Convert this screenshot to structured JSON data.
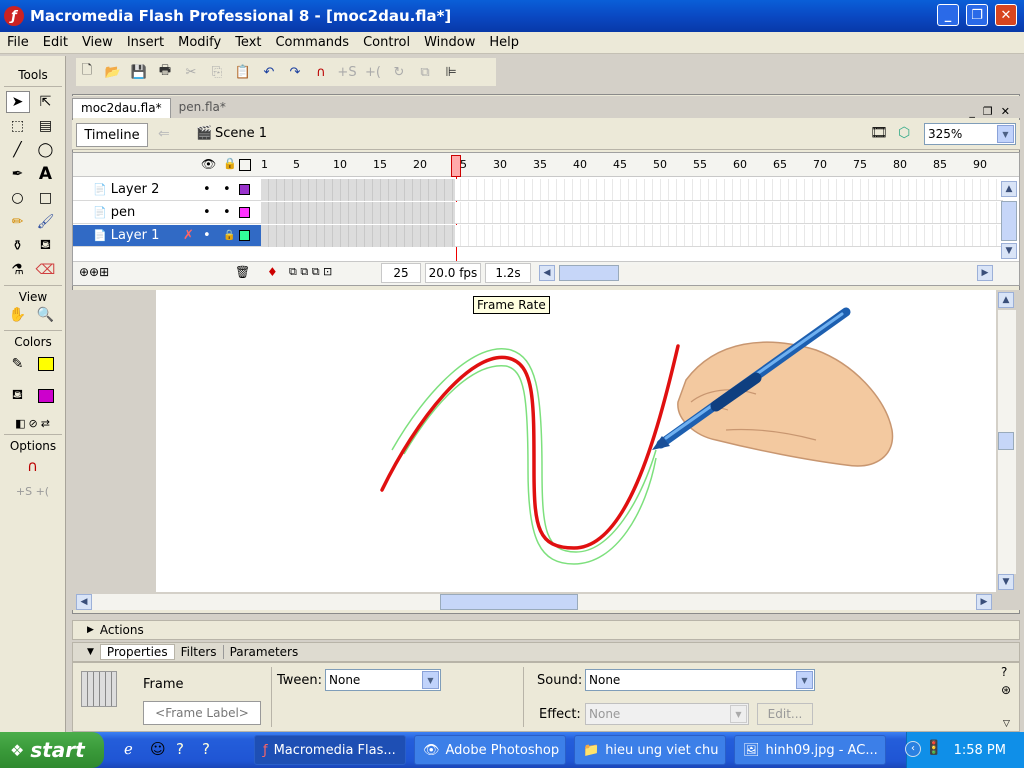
{
  "window": {
    "title": "Macromedia Flash Professional 8 - [moc2dau.fla*]",
    "app_icon": "flash-icon",
    "controls": [
      "minimize",
      "maximize",
      "close"
    ]
  },
  "menu": [
    "File",
    "Edit",
    "View",
    "Insert",
    "Modify",
    "Text",
    "Commands",
    "Control",
    "Window",
    "Help"
  ],
  "tools": {
    "title": "Tools",
    "view_label": "View",
    "colors_label": "Colors",
    "options_label": "Options",
    "stroke_color": "#000000",
    "fill_color": "#ffff00",
    "swatch_color": "#cc00cc"
  },
  "documents": {
    "tabs": [
      "moc2dau.fla*",
      "pen.fla*"
    ],
    "active": 0
  },
  "edit_bar": {
    "timeline_button": "Timeline",
    "scene": "Scene 1",
    "zoom": "325%"
  },
  "timeline": {
    "frame_numbers": [
      "1",
      "5",
      "10",
      "15",
      "20",
      "25",
      "30",
      "35",
      "40",
      "45",
      "50",
      "55",
      "60",
      "65",
      "70",
      "75",
      "80",
      "85",
      "90"
    ],
    "layers": [
      {
        "name": "Layer 2",
        "color": "#9933cc",
        "selected": false
      },
      {
        "name": "pen",
        "color": "#ff33ff",
        "selected": false
      },
      {
        "name": "Layer 1",
        "color": "#33ff99",
        "selected": true
      }
    ],
    "current_frame": "25",
    "frame_rate": "20.0 fps",
    "elapsed": "1.2s"
  },
  "tooltip": "Frame Rate",
  "panels": {
    "actions": "Actions",
    "tabs": [
      "Properties",
      "Filters",
      "Parameters"
    ],
    "frame_label": "Frame",
    "frame_label_placeholder": "<Frame Label>",
    "tween_label": "Tween:",
    "tween_value": "None",
    "sound_label": "Sound:",
    "sound_value": "None",
    "effect_label": "Effect:",
    "effect_value": "None",
    "edit_button": "Edit..."
  },
  "taskbar": {
    "start": "start",
    "tasks": [
      "Macromedia Flas...",
      "Adobe Photoshop",
      "hieu ung viet chu",
      "hinh09.jpg - AC..."
    ],
    "clock": "1:58 PM"
  }
}
